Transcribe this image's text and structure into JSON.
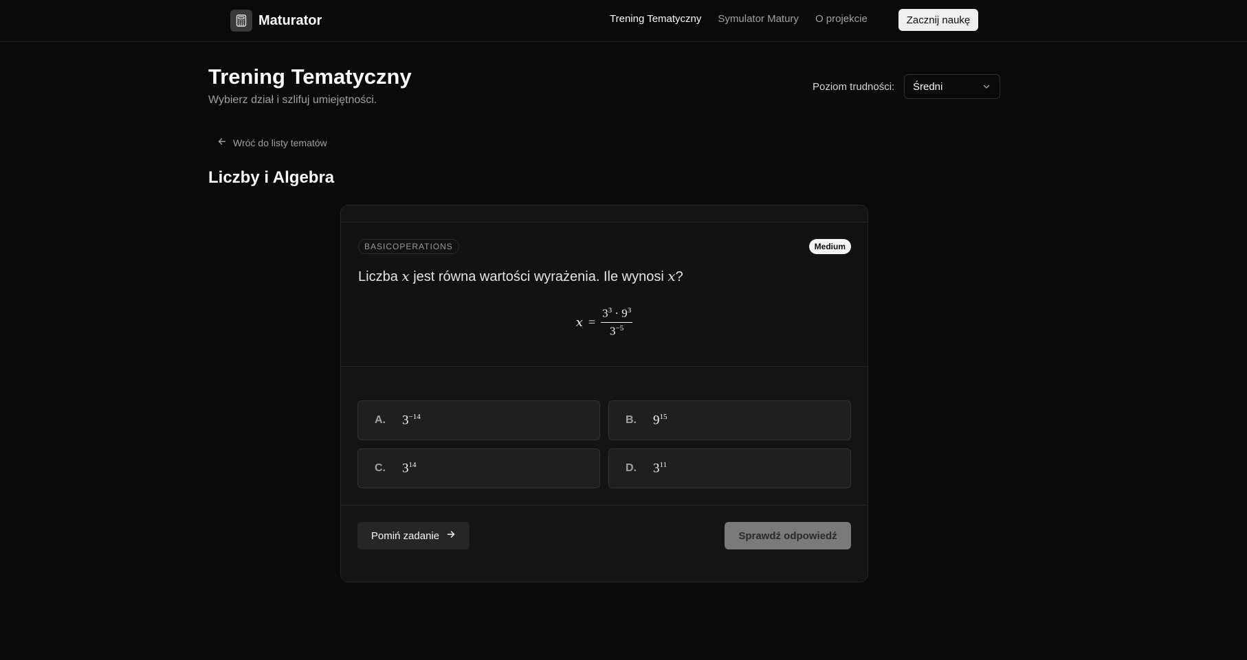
{
  "header": {
    "brand": "Maturator",
    "nav": [
      "Trening Tematyczny",
      "Symulator Matury",
      "O projekcie"
    ],
    "cta": "Zacznij naukę"
  },
  "page": {
    "title": "Trening Tematyczny",
    "subtitle": "Wybierz dział i szlifuj umiejętności.",
    "difficulty_label": "Poziom trudności:",
    "difficulty_value": "Średni"
  },
  "back_link": "Wróć do listy tematów",
  "section_title": "Liczby i Algebra",
  "card": {
    "tag": "BASICOPERATIONS",
    "level": "Medium",
    "question": {
      "before": "Liczba ",
      "var": "x",
      "middle": " jest równa wartości wyrażenia. Ile wynosi ",
      "var2": "x",
      "after": "?"
    },
    "formula": {
      "lhs": "x",
      "eq": "=",
      "num_base1": "3",
      "num_exp1": "3",
      "dot": "·",
      "num_base2": "9",
      "num_exp2": "3",
      "den_base": "3",
      "den_exp": "−5"
    },
    "answers": [
      {
        "letter": "A.",
        "base": "3",
        "exp": "−14"
      },
      {
        "letter": "B.",
        "base": "9",
        "exp": "15"
      },
      {
        "letter": "C.",
        "base": "3",
        "exp": "14"
      },
      {
        "letter": "D.",
        "base": "3",
        "exp": "11"
      }
    ],
    "skip_label": "Pomiń zadanie",
    "check_label": "Sprawdź odpowiedź"
  },
  "icons": {
    "brand": "calculator-icon",
    "select": "chevron-down-icon",
    "back": "arrow-left-icon",
    "skip": "arrow-right-icon"
  },
  "colors": {
    "background": "#0a0a0a",
    "card": "#141414",
    "check_button": "#7a7a7a"
  }
}
